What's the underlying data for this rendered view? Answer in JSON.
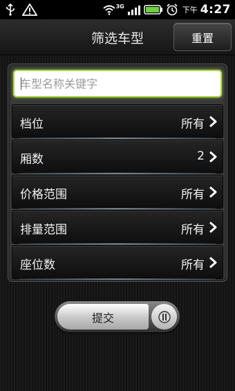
{
  "status_bar": {
    "icons": [
      "usb-icon",
      "warning-icon",
      "wifi-icon",
      "3g-signal-icon",
      "battery-icon",
      "alarm-icon"
    ],
    "network_label": "3G",
    "ampm": "下午",
    "time": "4:27"
  },
  "header": {
    "title": "筛选车型",
    "reset_label": "重置"
  },
  "search": {
    "placeholder": "车型名称关键字",
    "value": ""
  },
  "filters": [
    {
      "label": "档位",
      "value": "所有"
    },
    {
      "label": "厢数",
      "value": "2"
    },
    {
      "label": "价格范围",
      "value": "所有"
    },
    {
      "label": "排量范围",
      "value": "所有"
    },
    {
      "label": "座位数",
      "value": "所有"
    }
  ],
  "submit_label": "提交",
  "colors": {
    "search_focus": "#aed84a",
    "background": "#151515"
  }
}
